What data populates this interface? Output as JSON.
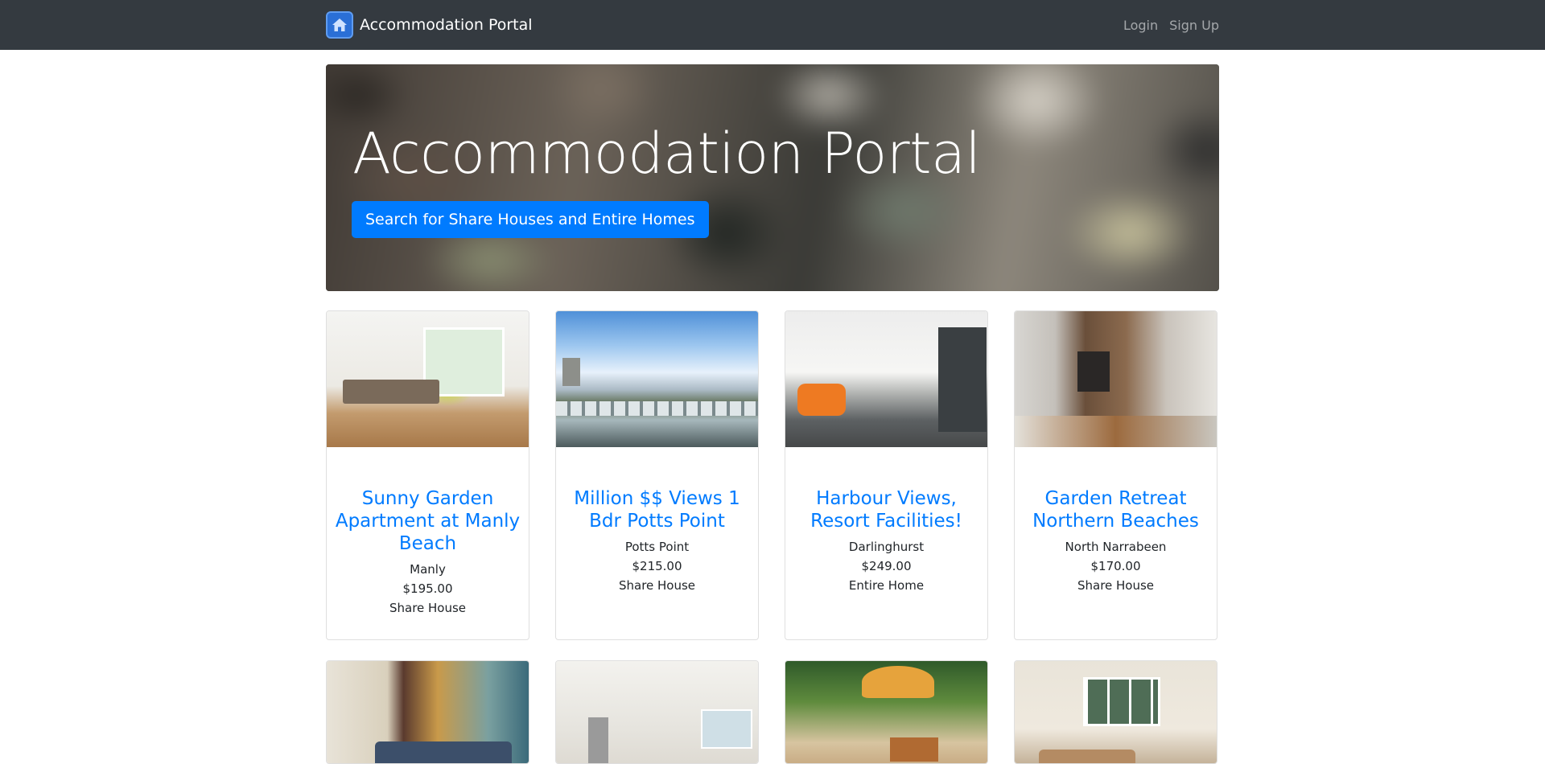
{
  "navbar": {
    "brand": "Accommodation Portal",
    "logo_icon": "house-icon",
    "login": "Login",
    "signup": "Sign Up"
  },
  "hero": {
    "title": "Accommodation Portal",
    "search_button": "Search for Share Houses and Entire Homes"
  },
  "listings": [
    {
      "title": "Sunny Garden Apartment at Manly Beach",
      "suburb": "Manly",
      "price": "$195.00",
      "type": "Share House"
    },
    {
      "title": "Million $$ Views 1 Bdr Potts Point",
      "suburb": "Potts Point",
      "price": "$215.00",
      "type": "Share House"
    },
    {
      "title": "Harbour Views, Resort Facilities!",
      "suburb": "Darlinghurst",
      "price": "$249.00",
      "type": "Entire Home"
    },
    {
      "title": "Garden Retreat Northern Beaches",
      "suburb": "North Narrabeen",
      "price": "$170.00",
      "type": "Share House"
    }
  ],
  "colors": {
    "navbar_bg": "#343a40",
    "primary": "#007bff"
  }
}
